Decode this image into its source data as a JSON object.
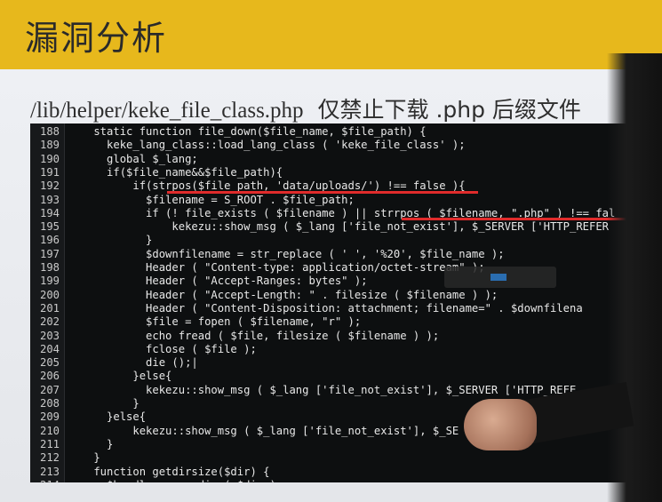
{
  "slide": {
    "title": "漏洞分析",
    "subtitle_path": "/lib/helper/keke_file_class.php",
    "subtitle_note": "仅禁止下载 .php 后缀文件"
  },
  "code": {
    "lines": [
      {
        "no": "188",
        "text": "    static function file_down($file_name, $file_path) {"
      },
      {
        "no": "189",
        "text": "      keke_lang_class::load_lang_class ( 'keke_file_class' );"
      },
      {
        "no": "190",
        "text": "      global $_lang;"
      },
      {
        "no": "191",
        "text": "      if($file_name&&$file_path){"
      },
      {
        "no": "192",
        "text": "          if(strpos($file_path, 'data/uploads/') !== false ){"
      },
      {
        "no": "193",
        "text": "            $filename = S_ROOT . $file_path;"
      },
      {
        "no": "194",
        "text": "            if (! file_exists ( $filename ) || strrpos ( $filename, \".php\" ) !== fal"
      },
      {
        "no": "195",
        "text": "                kekezu::show_msg ( $_lang ['file_not_exist'], $_SERVER ['HTTP_REFER"
      },
      {
        "no": "196",
        "text": "            }"
      },
      {
        "no": "197",
        "text": "            $downfilename = str_replace ( ' ', '%20', $file_name );"
      },
      {
        "no": "198",
        "text": "            Header ( \"Content-type: application/octet-stream\" );"
      },
      {
        "no": "199",
        "text": "            Header ( \"Accept-Ranges: bytes\" );"
      },
      {
        "no": "200",
        "text": "            Header ( \"Accept-Length: \" . filesize ( $filename ) );"
      },
      {
        "no": "201",
        "text": "            Header ( \"Content-Disposition: attachment; filename=\" . $downfilena"
      },
      {
        "no": "202",
        "text": "            $file = fopen ( $filename, \"r\" );"
      },
      {
        "no": "203",
        "text": "            echo fread ( $file, filesize ( $filename ) );"
      },
      {
        "no": "204",
        "text": "            fclose ( $file );"
      },
      {
        "no": "205",
        "text": "            die ();|"
      },
      {
        "no": "206",
        "text": "          }else{"
      },
      {
        "no": "207",
        "text": "            kekezu::show_msg ( $_lang ['file_not_exist'], $_SERVER ['HTTP_REFE"
      },
      {
        "no": "208",
        "text": "          }"
      },
      {
        "no": "209",
        "text": "      }else{"
      },
      {
        "no": "210",
        "text": "          kekezu::show_msg ( $_lang ['file_not_exist'], $_SE"
      },
      {
        "no": "211",
        "text": "      }"
      },
      {
        "no": "212",
        "text": "    }"
      },
      {
        "no": "213",
        "text": "    function getdirsize($dir) {"
      },
      {
        "no": "214",
        "text": "      $handle = opendir ( $dir );"
      }
    ]
  },
  "colors": {
    "banner": "#e7b81c",
    "code_bg": "#0d0f10",
    "highlight_underline": "#e02b2b",
    "keyword": "#5fb0ff"
  }
}
